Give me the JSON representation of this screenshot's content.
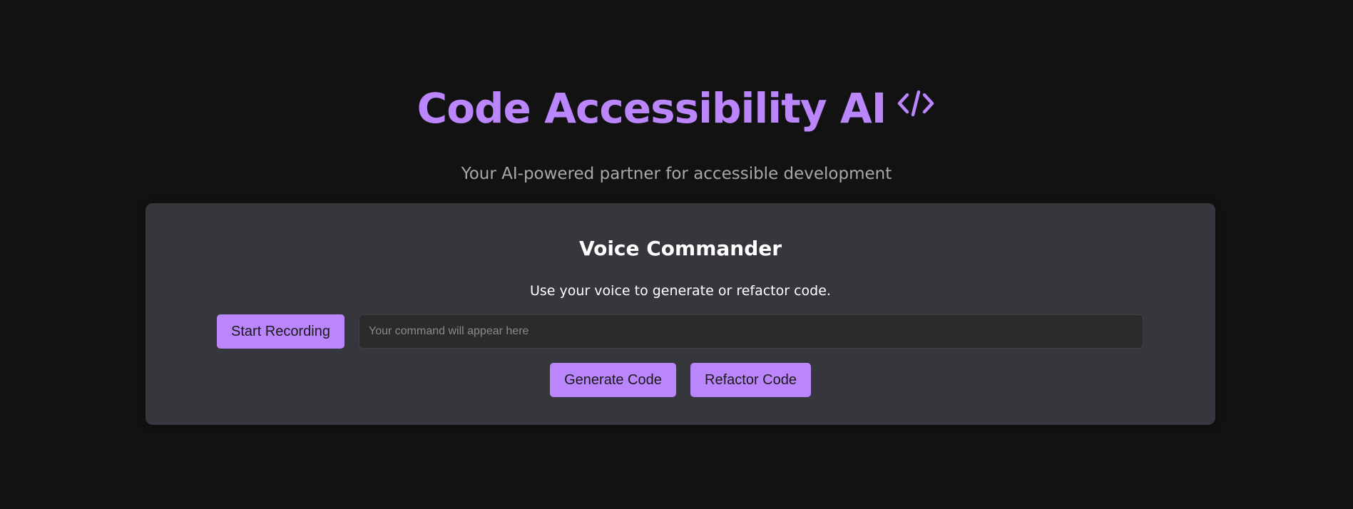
{
  "header": {
    "title": "Code Accessibility AI",
    "icon": "code-icon",
    "subtitle": "Your AI-powered partner for accessible development"
  },
  "card": {
    "title": "Voice Commander",
    "description": "Use your voice to generate or refactor code.",
    "record_button": "Start Recording",
    "command_input": {
      "value": "",
      "placeholder": "Your command will appear here"
    },
    "generate_button": "Generate Code",
    "refactor_button": "Refactor Code"
  },
  "colors": {
    "background": "#121212",
    "accent": "#bb86fc",
    "card": "#36363d",
    "input_bg": "#2b2b2b"
  }
}
